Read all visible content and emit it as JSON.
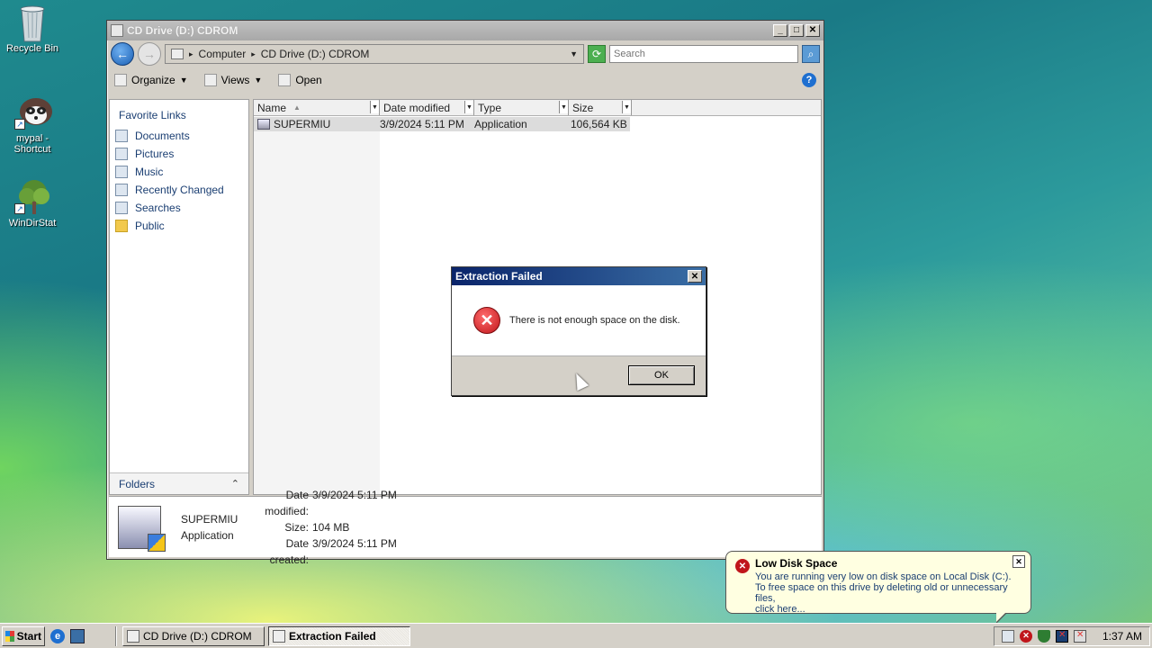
{
  "desktop": {
    "icons": [
      {
        "label": "Recycle Bin"
      },
      {
        "label": "mypal - Shortcut"
      },
      {
        "label": "WinDirStat"
      }
    ]
  },
  "window": {
    "title": "CD Drive (D:) CDROM",
    "controls": {
      "minimize": "_",
      "maximize": "□",
      "close": "✕"
    },
    "address": {
      "crumbs": [
        "Computer",
        "CD Drive (D:) CDROM"
      ]
    },
    "search": {
      "placeholder": "Search"
    },
    "toolbar": {
      "organize": "Organize",
      "views": "Views",
      "open": "Open",
      "help": "?"
    },
    "nav": {
      "favorite_links": "Favorite Links",
      "items": [
        "Documents",
        "Pictures",
        "Music",
        "Recently Changed",
        "Searches",
        "Public"
      ],
      "folders": "Folders"
    },
    "columns": [
      "Name",
      "Date modified",
      "Type",
      "Size"
    ],
    "files": [
      {
        "name": "SUPERMIU",
        "date": "3/9/2024 5:11 PM",
        "type": "Application",
        "size": "106,564 KB"
      }
    ],
    "details": {
      "name": "SUPERMIU",
      "kind": "Application",
      "modified_label": "Date modified:",
      "modified": "3/9/2024 5:11 PM",
      "size_label": "Size:",
      "size": "104 MB",
      "created_label": "Date created:",
      "created": "3/9/2024 5:11 PM"
    }
  },
  "dialog": {
    "title": "Extraction Failed",
    "message": "There is not enough space on the disk.",
    "ok": "OK"
  },
  "balloon": {
    "title": "Low Disk Space",
    "line1": "You are running very low on disk space on Local Disk (C:).",
    "line2": "To free space on this drive by deleting old or unnecessary files,",
    "line3": "click here..."
  },
  "taskbar": {
    "start": "Start",
    "tasks": [
      "CD Drive (D:) CDROM",
      "Extraction Failed"
    ],
    "clock": "1:37 AM"
  }
}
